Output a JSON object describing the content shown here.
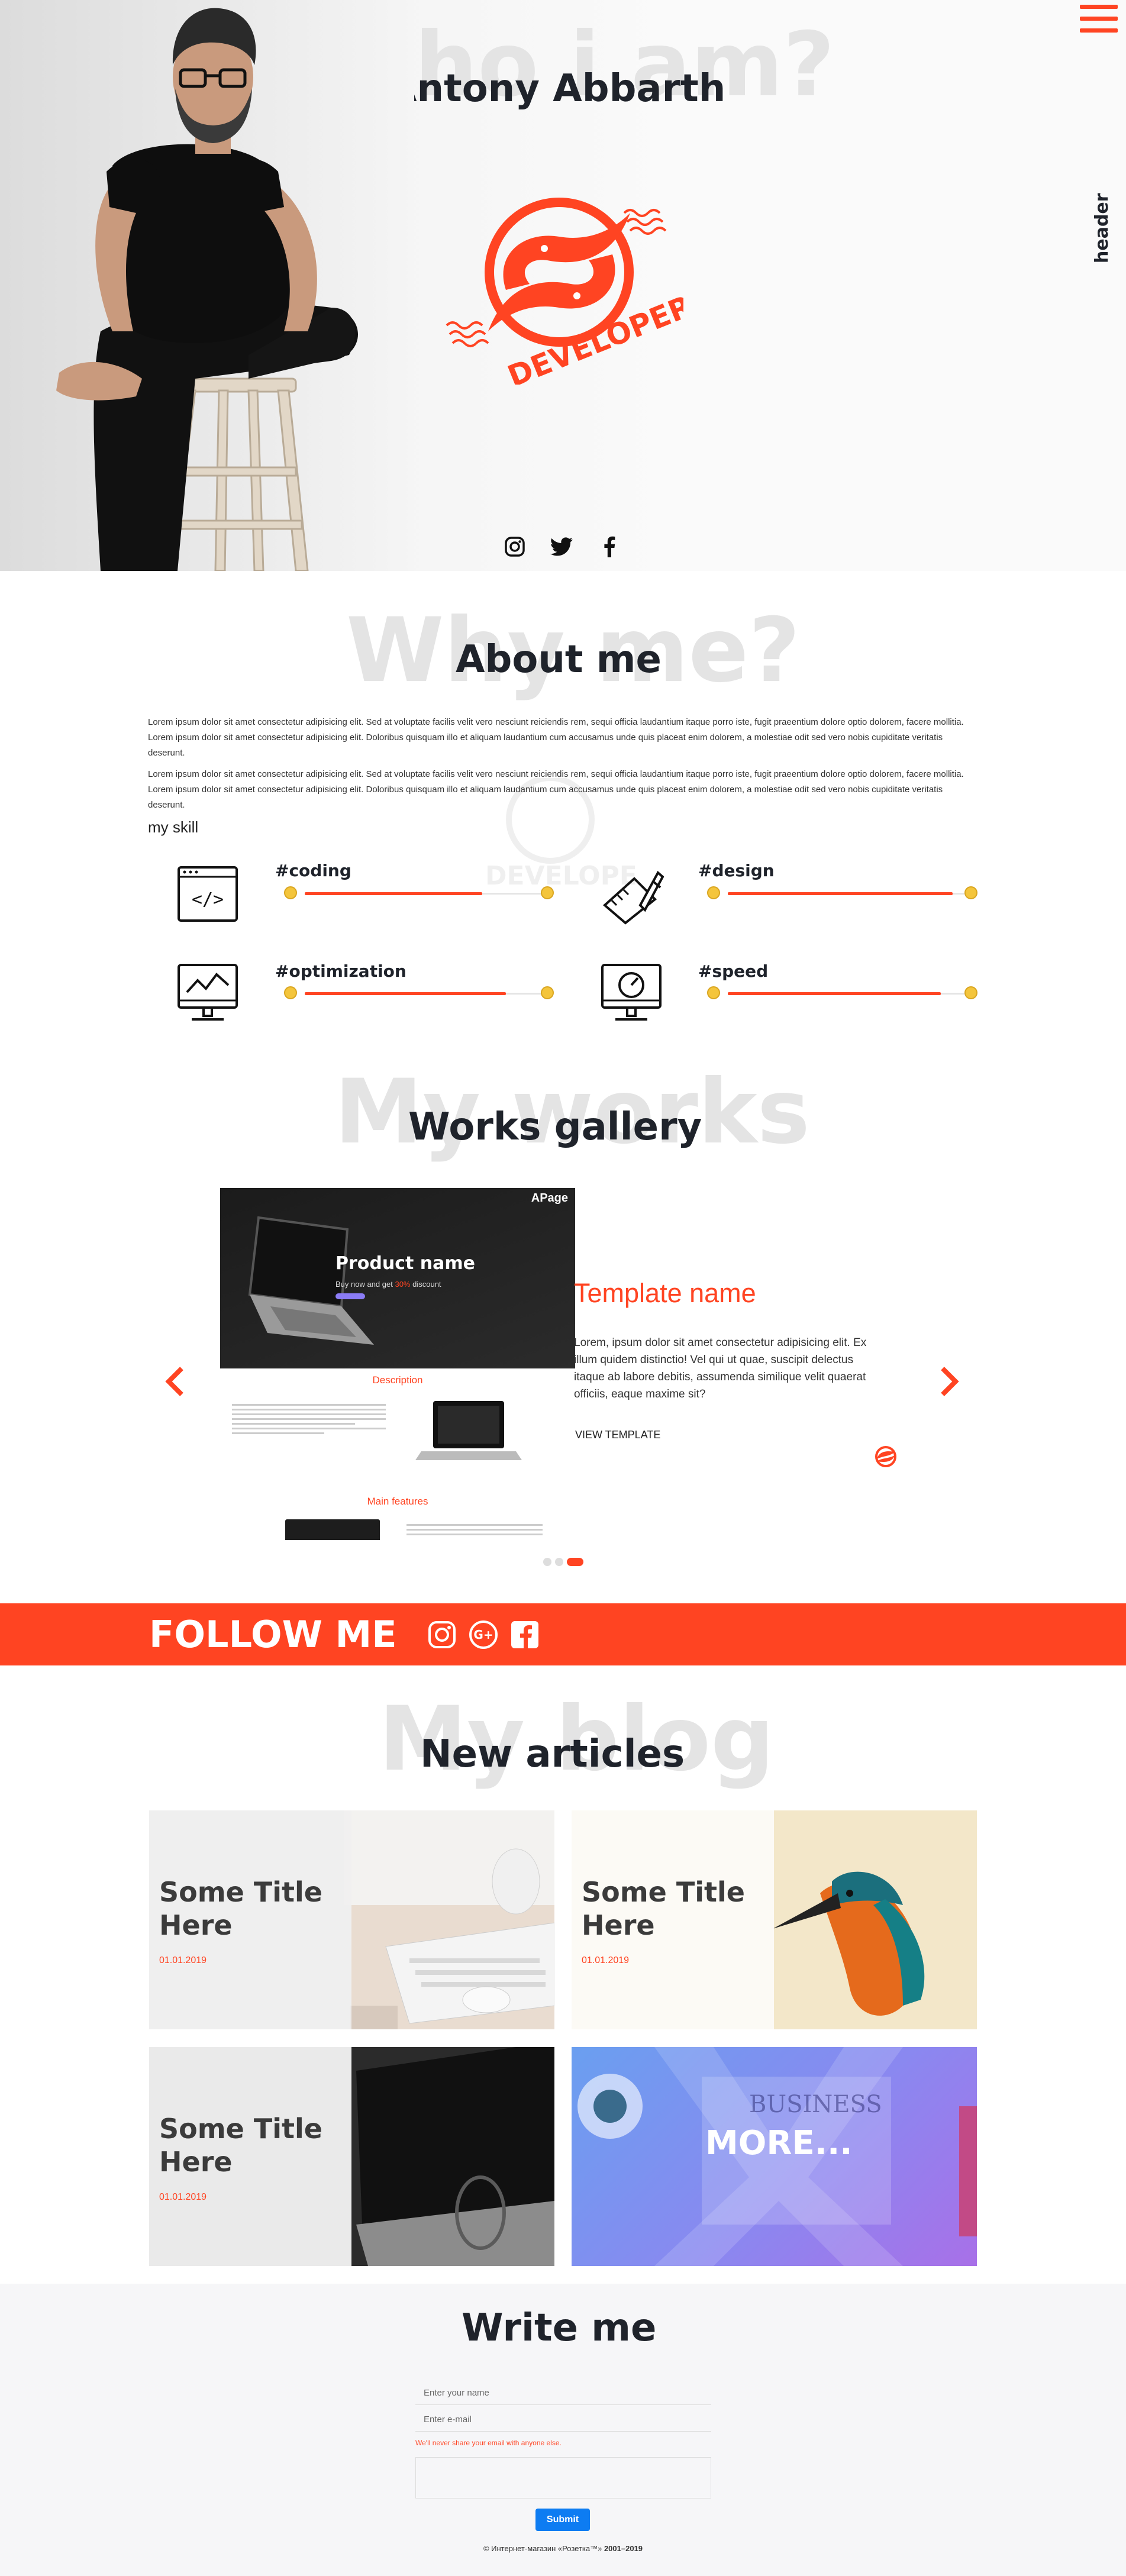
{
  "hero": {
    "ghost_title": "Who i am?",
    "name": "Antony Abbarth",
    "logo_text": "DEVELOPER",
    "side_label": "header",
    "socials": [
      "instagram-icon",
      "twitter-icon",
      "facebook-icon"
    ]
  },
  "about": {
    "ghost_title": "Why me?",
    "title": "About me",
    "paragraphs": [
      "Lorem ipsum dolor sit amet consectetur adipisicing elit. Sed at voluptate facilis velit vero nesciunt reiciendis rem, sequi officia laudantium itaque porro iste, fugit praeentium dolore optio dolorem, facere mollitia. Lorem ipsum dolor sit amet consectetur adipisicing elit. Doloribus quisquam illo et aliquam laudantium cum accusamus unde quis placeat enim dolorem, a molestiae odit sed vero nobis cupiditate veritatis deserunt.",
      "Lorem ipsum dolor sit amet consectetur adipisicing elit. Sed at voluptate facilis velit vero nesciunt reiciendis rem, sequi officia laudantium itaque porro iste, fugit praeentium dolore optio dolorem, facere mollitia. Lorem ipsum dolor sit amet consectetur adipisicing elit. Doloribus quisquam illo et aliquam laudantium cum accusamus unde quis placeat enim dolorem, a molestiae odit sed vero nobis cupiditate veritatis deserunt."
    ],
    "skills_heading": "my skill",
    "skills": [
      {
        "name": "#coding",
        "level": 0.75,
        "icon": "code-monitor-icon"
      },
      {
        "name": "#design",
        "level": 0.95,
        "icon": "design-tools-icon"
      },
      {
        "name": "#optimization",
        "level": 0.85,
        "icon": "chart-monitor-icon"
      },
      {
        "name": "#speed",
        "level": 0.9,
        "icon": "speedometer-monitor-icon"
      }
    ]
  },
  "works": {
    "ghost_title": "My works",
    "title": "Works gallery",
    "preview": {
      "brand": "APage",
      "product": "Product name",
      "discount_prefix": "Buy now and get ",
      "discount_value": "30%",
      "discount_suffix": " discount",
      "description": "Description",
      "main_features": "Main features"
    },
    "template_name": "Template name",
    "template_text": "Lorem, ipsum dolor sit amet consectetur adipisicing elit. Ex illum quidem distinctio! Vel qui ut quae, suscipit delectus itaque ab labore debitis, assumenda similique velit quaerat officiis, eaque maxime sit?",
    "view_label": "VIEW TEMPLATE",
    "dots": 3,
    "active_dot": 2
  },
  "follow": {
    "label": "FOLLOW ME",
    "icons": [
      "instagram-icon",
      "google-plus-icon",
      "facebook-icon"
    ]
  },
  "blog": {
    "ghost_title": "My blog",
    "title": "New articles",
    "cards": [
      {
        "title": "Some Title Here",
        "date": "01.01.2019"
      },
      {
        "title": "Some Title Here",
        "date": "01.01.2019"
      },
      {
        "title": "Some Title Here",
        "date": "01.01.2019"
      }
    ],
    "more_label": "MORE...",
    "more_bg_word": "BUSINESS"
  },
  "write": {
    "title": "Write me",
    "name_placeholder": "Enter your name",
    "email_placeholder": "Enter e-mail",
    "email_help": "We'll never share your email with anyone else.",
    "submit_label": "Submit",
    "footer_prefix": "© Интернет-магазин «Розетка™» ",
    "footer_years": "2001–2019"
  },
  "colors": {
    "accent": "#ff4422",
    "dark": "#1f232b",
    "submit": "#0d7cf2"
  }
}
